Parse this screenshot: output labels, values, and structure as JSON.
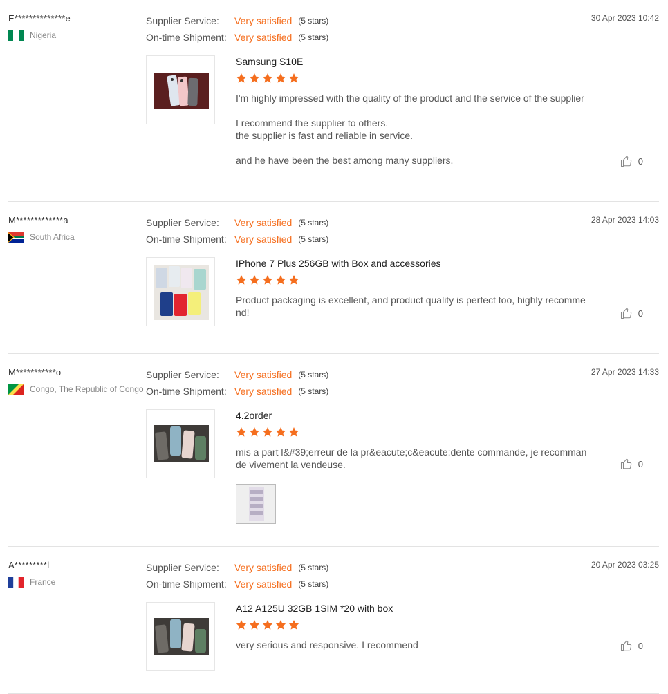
{
  "labels": {
    "supplier_service": "Supplier Service:",
    "on_time_shipment": "On-time Shipment:"
  },
  "colors": {
    "accent": "#f56e1e",
    "divider": "#e3e3e3"
  },
  "reviews": [
    {
      "buyer": "E**************e",
      "country": "Nigeria",
      "flag": "nigeria-flag",
      "supplier_service": "Very satisfied",
      "supplier_service_stars": "(5 stars)",
      "shipment": "Very satisfied",
      "shipment_stars": "(5 stars)",
      "date": "30 Apr 2023 10:42",
      "product": "Samsung S10E",
      "rating": 5,
      "text_lines": [
        "I'm highly impressed with the quality of the product and the service of the supplier",
        "",
        "I recommend the supplier to others.",
        "the supplier is fast and reliable in service.",
        "",
        "and he have been the best among many suppliers."
      ],
      "likes": "0"
    },
    {
      "buyer": "M*************a",
      "country": "South Africa",
      "flag": "south-africa-flag",
      "supplier_service": "Very satisfied",
      "supplier_service_stars": "(5 stars)",
      "shipment": "Very satisfied",
      "shipment_stars": "(5 stars)",
      "date": "28 Apr 2023 14:03",
      "product": "IPhone 7 Plus 256GB with Box and accessories",
      "rating": 5,
      "text_lines": [
        "Product packaging is excellent, and product quality is perfect too, highly recomme",
        "nd!"
      ],
      "likes": "0"
    },
    {
      "buyer": "M***********o",
      "country": "Congo, The Republic of Congo",
      "flag": "congo-flag",
      "supplier_service": "Very satisfied",
      "supplier_service_stars": "(5 stars)",
      "shipment": "Very satisfied",
      "shipment_stars": "(5 stars)",
      "date": "27 Apr 2023 14:33",
      "product": "4.2order",
      "rating": 5,
      "text_lines": [
        "mis a part l&#39;erreur de la pr&eacute;c&eacute;dente commande, je recomman",
        "de vivement la vendeuse."
      ],
      "likes": "0"
    },
    {
      "buyer": "A*********l",
      "country": "France",
      "flag": "france-flag",
      "supplier_service": "Very satisfied",
      "supplier_service_stars": "(5 stars)",
      "shipment": "Very satisfied",
      "shipment_stars": "(5 stars)",
      "date": "20 Apr 2023 03:25",
      "product": "A12 A125U 32GB 1SIM *20 with box",
      "rating": 5,
      "text_lines": [
        "very serious and responsive.  I recommend"
      ],
      "likes": "0"
    }
  ]
}
